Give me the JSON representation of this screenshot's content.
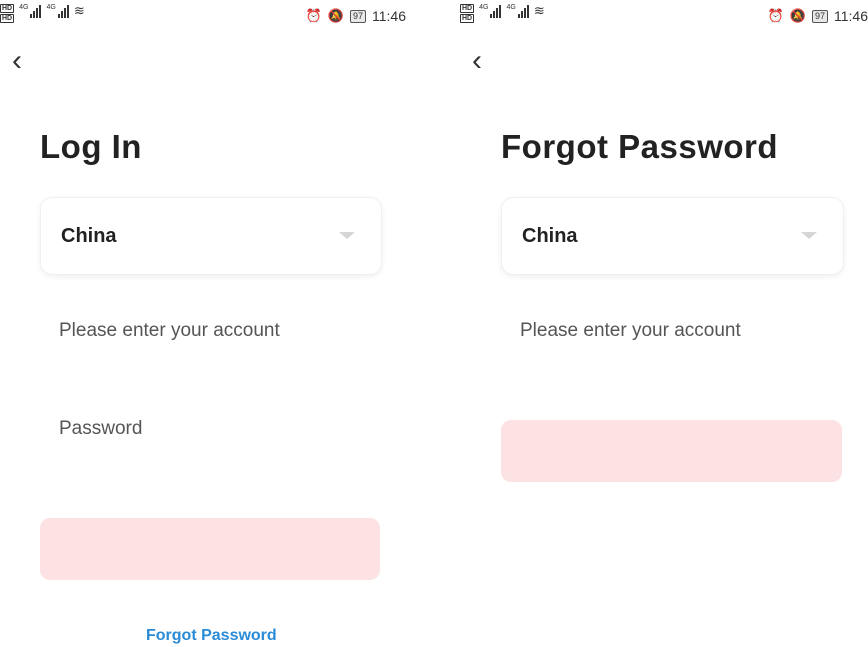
{
  "screens": {
    "login": {
      "status": {
        "network_tag": "4G",
        "time": "11:46",
        "battery": "97"
      },
      "title": "Log In",
      "region": {
        "value": "China"
      },
      "account": {
        "placeholder": "Please enter your account"
      },
      "password": {
        "placeholder": "Password"
      },
      "login_button": {
        "label": ""
      },
      "forgot_link": "Forgot Password"
    },
    "forgot": {
      "status": {
        "network_tag": "4G",
        "time": "11:46",
        "battery": "97"
      },
      "title": "Forgot Password",
      "region": {
        "value": "China"
      },
      "account": {
        "placeholder": "Please enter your account"
      },
      "code_button": {
        "label": ""
      }
    }
  },
  "icons": {
    "back": "chevron-left-icon",
    "dropdown": "caret-down-icon",
    "alarm": "alarm-icon",
    "mute": "bell-off-icon",
    "wifi": "wifi-icon",
    "battery": "battery-icon"
  },
  "colors": {
    "primary_disabled": "#fde2e3",
    "link": "#2a8bd6",
    "title": "#222222"
  }
}
